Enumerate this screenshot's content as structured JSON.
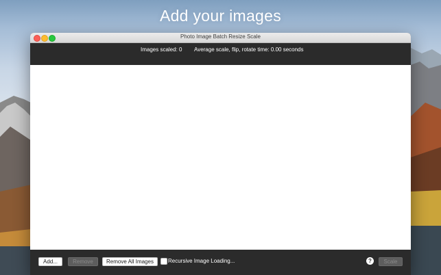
{
  "headline": "Add your images",
  "window": {
    "title": "Photo Image Batch Resize Scale",
    "status": {
      "images_scaled": "Images scaled: 0",
      "average_time": "Average scale, flip, rotate time: 0.00 seconds"
    },
    "buttons": {
      "add": "Add...",
      "remove": "Remove",
      "remove_all": "Remove All Images",
      "scale": "Scale"
    },
    "recursive_label": "Recursive Image Loading...",
    "recursive_checked": false,
    "help_glyph": "?"
  },
  "colors": {
    "window_dark": "#2b2b2b",
    "close": "#fc5f57",
    "minimize": "#fdbc2e",
    "maximize": "#28c840"
  }
}
